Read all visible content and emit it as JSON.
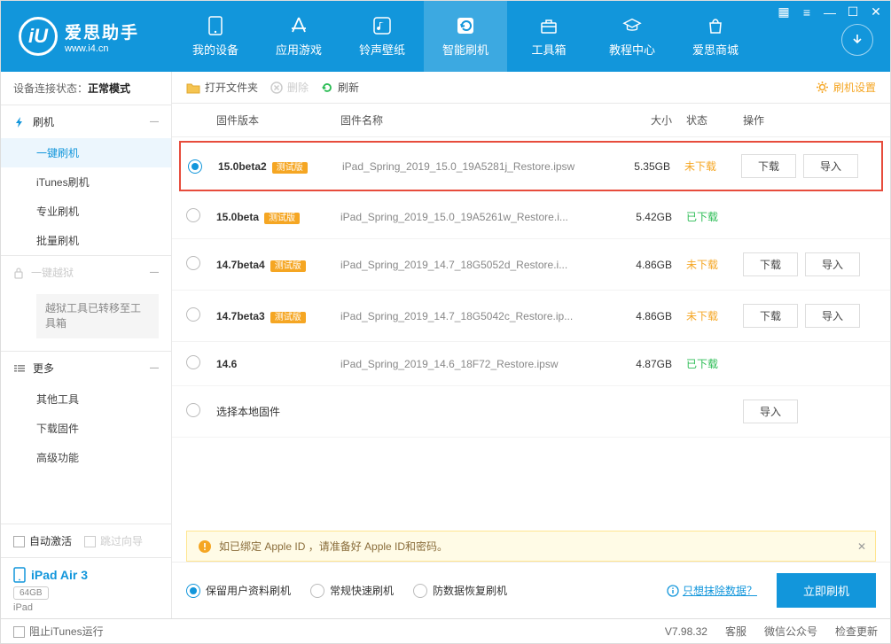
{
  "app": {
    "name": "爱思助手",
    "url": "www.i4.cn"
  },
  "nav": [
    {
      "label": "我的设备"
    },
    {
      "label": "应用游戏"
    },
    {
      "label": "铃声壁纸"
    },
    {
      "label": "智能刷机"
    },
    {
      "label": "工具箱"
    },
    {
      "label": "教程中心"
    },
    {
      "label": "爱思商城"
    }
  ],
  "sidebar": {
    "conn_label": "设备连接状态：",
    "conn_value": "正常模式",
    "flash": {
      "header": "刷机",
      "items": [
        "一键刷机",
        "iTunes刷机",
        "专业刷机",
        "批量刷机"
      ]
    },
    "jailbreak": {
      "header": "一键越狱",
      "note": "越狱工具已转移至工具箱"
    },
    "more": {
      "header": "更多",
      "items": [
        "其他工具",
        "下载固件",
        "高级功能"
      ]
    },
    "auto_activate": "自动激活",
    "skip_wizard": "跳过向导",
    "device": {
      "name": "iPad Air 3",
      "storage": "64GB",
      "type": "iPad"
    }
  },
  "toolbar": {
    "open": "打开文件夹",
    "delete": "删除",
    "refresh": "刷新",
    "settings": "刷机设置"
  },
  "table": {
    "headers": {
      "version": "固件版本",
      "name": "固件名称",
      "size": "大小",
      "status": "状态",
      "actions": "操作"
    },
    "rows": [
      {
        "version": "15.0beta2",
        "badge": "测试版",
        "name": "iPad_Spring_2019_15.0_19A5281j_Restore.ipsw",
        "size": "5.35GB",
        "status": "未下载",
        "status_type": "not",
        "selected": true,
        "highlight": true,
        "download": true,
        "import": true
      },
      {
        "version": "15.0beta",
        "badge": "测试版",
        "name": "iPad_Spring_2019_15.0_19A5261w_Restore.i...",
        "size": "5.42GB",
        "status": "已下载",
        "status_type": "done",
        "selected": false
      },
      {
        "version": "14.7beta4",
        "badge": "测试版",
        "name": "iPad_Spring_2019_14.7_18G5052d_Restore.i...",
        "size": "4.86GB",
        "status": "未下载",
        "status_type": "not",
        "selected": false,
        "download": true,
        "import": true
      },
      {
        "version": "14.7beta3",
        "badge": "测试版",
        "name": "iPad_Spring_2019_14.7_18G5042c_Restore.ip...",
        "size": "4.86GB",
        "status": "未下载",
        "status_type": "not",
        "selected": false,
        "download": true,
        "import": true
      },
      {
        "version": "14.6",
        "badge": "",
        "name": "iPad_Spring_2019_14.6_18F72_Restore.ipsw",
        "size": "4.87GB",
        "status": "已下载",
        "status_type": "done",
        "selected": false
      }
    ],
    "local": "选择本地固件",
    "btn_download": "下载",
    "btn_import": "导入"
  },
  "alert": {
    "text": "如已绑定 Apple ID ，请准备好 Apple ID和密码。"
  },
  "flash_options": {
    "keep_data": "保留用户资料刷机",
    "normal": "常规快速刷机",
    "anti_data": "防数据恢复刷机",
    "erase_link": "只想抹除数据？",
    "primary": "立即刷机"
  },
  "footer": {
    "block_itunes": "阻止iTunes运行",
    "version": "V7.98.32",
    "service": "客服",
    "wechat": "微信公众号",
    "update": "检查更新"
  }
}
